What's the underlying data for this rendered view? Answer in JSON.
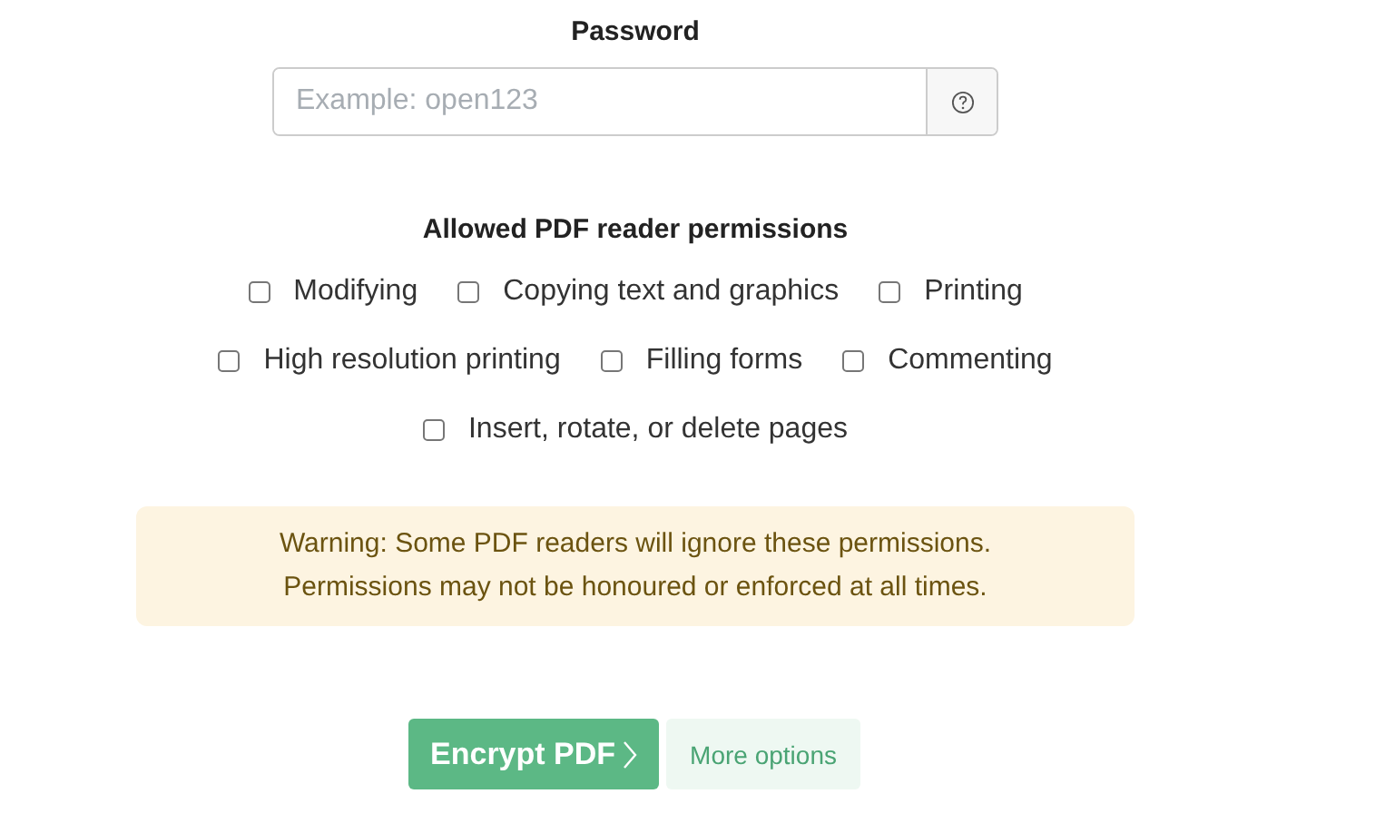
{
  "password": {
    "label": "Password",
    "placeholder": "Example: open123"
  },
  "permissions": {
    "heading": "Allowed PDF reader permissions",
    "rows": [
      [
        {
          "label": "Modifying",
          "checked": false
        },
        {
          "label": "Copying text and graphics",
          "checked": false
        },
        {
          "label": "Printing",
          "checked": false
        }
      ],
      [
        {
          "label": "High resolution printing",
          "checked": false
        },
        {
          "label": "Filling forms",
          "checked": false
        },
        {
          "label": "Commenting",
          "checked": false
        }
      ],
      [
        {
          "label": "Insert, rotate, or delete pages",
          "checked": false
        }
      ]
    ]
  },
  "warning": {
    "lines": [
      "Warning: Some PDF readers will ignore these permissions.",
      "Permissions may not be honoured or enforced at all times."
    ]
  },
  "buttons": {
    "primary": "Encrypt PDF",
    "secondary": "More options"
  }
}
